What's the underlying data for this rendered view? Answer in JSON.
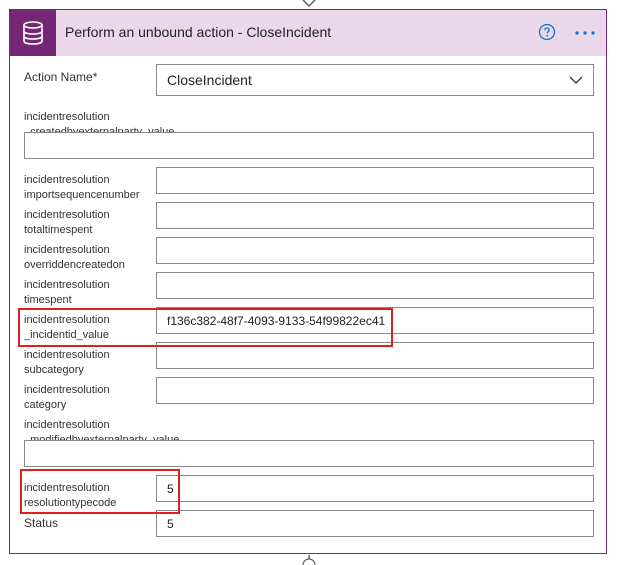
{
  "header": {
    "title": "Perform an unbound action - CloseIncident",
    "icons": [
      "database-icon",
      "help-icon",
      "more-options-icon"
    ]
  },
  "action_name": {
    "label": "Action Name",
    "required_marker": "*",
    "value": "CloseIncident"
  },
  "fields": {
    "createdbyexternalparty": {
      "line1": "incidentresolution",
      "line2": "_createdbyexternalparty_value",
      "value": ""
    },
    "importsequencenumber": {
      "line1": "incidentresolution",
      "line2": "importsequencenumber",
      "value": ""
    },
    "totaltimespent": {
      "line1": "incidentresolution",
      "line2": "totaltimespent",
      "value": ""
    },
    "overriddencreatedon": {
      "line1": "incidentresolution",
      "line2": "overriddencreatedon",
      "value": ""
    },
    "timespent": {
      "line1": "incidentresolution",
      "line2": "timespent",
      "value": ""
    },
    "incidentid": {
      "line1": "incidentresolution",
      "line2": "_incidentid_value",
      "value": "f136c382-48f7-4093-9133-54f99822ec41"
    },
    "subcategory": {
      "line1": "incidentresolution",
      "line2": "subcategory",
      "value": ""
    },
    "category": {
      "line1": "incidentresolution",
      "line2": "category",
      "value": ""
    },
    "modifiedbyexternalparty": {
      "line1": "incidentresolution",
      "line2": "_modifiedbyexternalparty_value",
      "value": ""
    },
    "resolutiontypecode": {
      "line1": "incidentresolution",
      "line2": "resolutiontypecode",
      "value": "5"
    },
    "status": {
      "label": "Status",
      "value": "5"
    }
  },
  "colors": {
    "accent": "#742774",
    "header_bg": "#ead7ea",
    "highlight": "#e02020"
  }
}
